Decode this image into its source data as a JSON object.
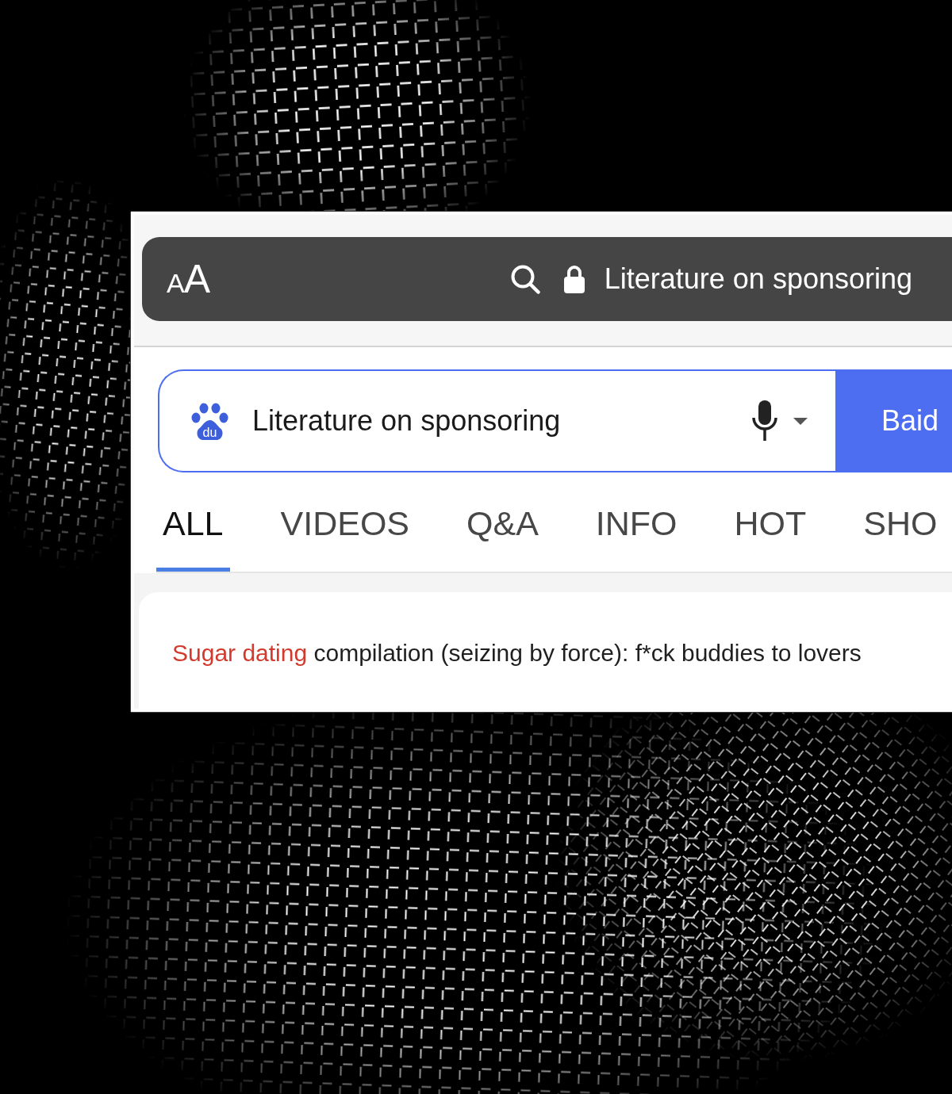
{
  "browser_bar": {
    "text_size_button": "AA",
    "url": "Literature on sponsoring"
  },
  "search_box": {
    "logo_text": "du",
    "value": "Literature on sponsoring",
    "button": "Baid"
  },
  "tabs": [
    {
      "label": "ALL",
      "selected": true
    },
    {
      "label": "VIDEOS",
      "selected": false
    },
    {
      "label": "Q&A",
      "selected": false
    },
    {
      "label": "INFO",
      "selected": false
    },
    {
      "label": "HOT",
      "selected": false
    },
    {
      "label": "SHO",
      "selected": false
    }
  ],
  "results": [
    {
      "title_parts": [
        {
          "text": "Sugar dating",
          "highlighted": true
        },
        {
          "text": " compilation (seizing by force): f*ck buddies to lovers",
          "highlighted": false
        }
      ]
    }
  ]
}
